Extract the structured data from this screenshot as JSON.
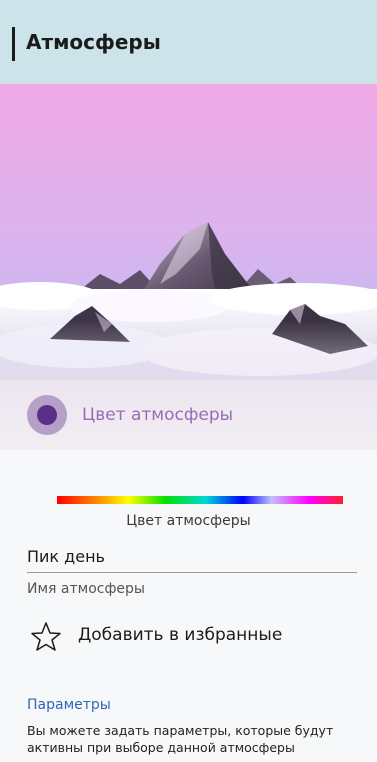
{
  "header": {
    "title": "Атмосферы"
  },
  "atmosphere_color": {
    "label": "Цвет атмосферы",
    "selected_color": "#5a2f88",
    "ring_color": "#b7a0c8"
  },
  "color_slider": {
    "caption": "Цвет атмосферы"
  },
  "name_field": {
    "value": "Пик день",
    "label": "Имя атмосферы"
  },
  "favorite": {
    "label": "Добавить в избранные",
    "icon": "star-outline-icon"
  },
  "parameters": {
    "title": "Параметры",
    "description": "Вы можете задать параметры, которые будут активны при выборе данной атмосферы"
  },
  "colors": {
    "header_bg": "#cce3ea",
    "link": "#3166b8",
    "accent": "#9b6bb3"
  }
}
